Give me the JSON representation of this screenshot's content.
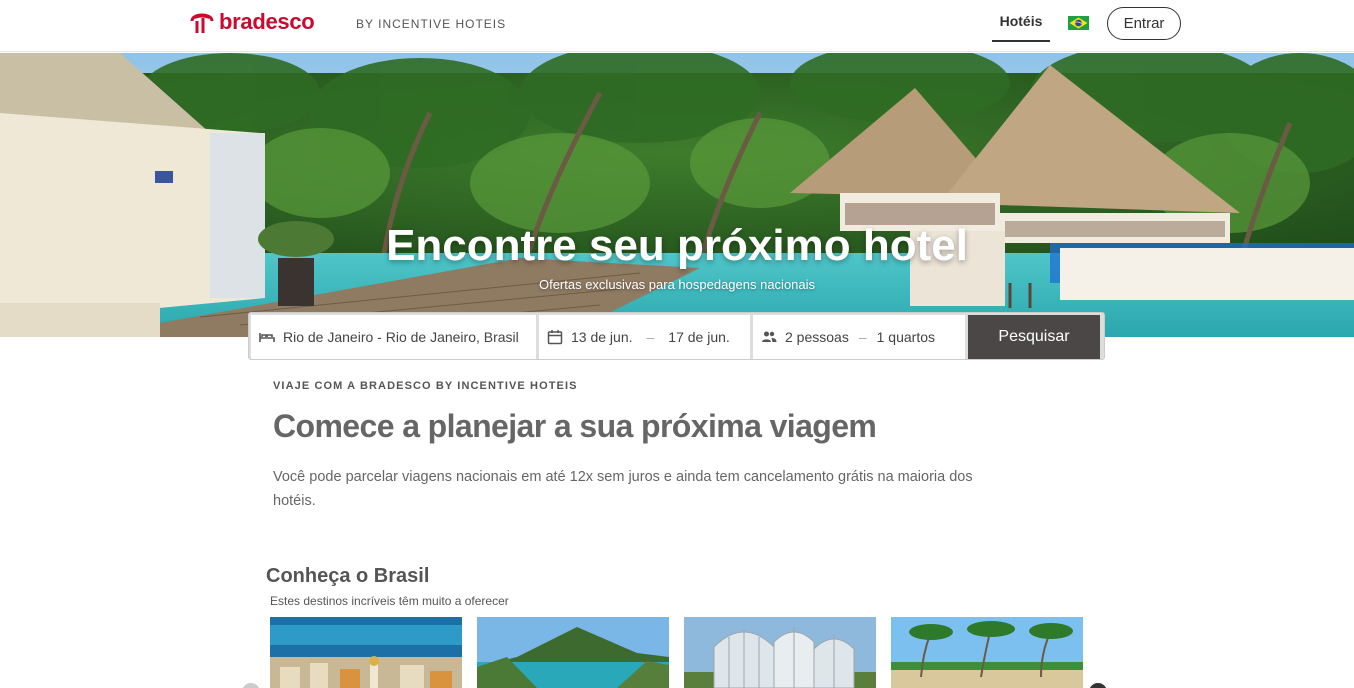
{
  "header": {
    "brand": "bradesco",
    "tagline": "BY INCENTIVE HOTEIS",
    "nav_hotels": "Hotéis",
    "login": "Entrar",
    "colors": {
      "brand": "#cc092f"
    }
  },
  "hero": {
    "title": "Encontre seu próximo hotel",
    "subtitle": "Ofertas exclusivas para hospedagens nacionais"
  },
  "search": {
    "destination": "Rio de Janeiro - Rio de Janeiro, Brasil",
    "checkin": "13 de jun.",
    "date_separator": "–",
    "checkout": "17 de jun.",
    "guests": "2 pessoas",
    "guests_separator": "–",
    "rooms": "1 quartos",
    "button": "Pesquisar",
    "icons": {
      "destination": "bed-icon",
      "dates": "calendar-icon",
      "guests": "people-icon"
    }
  },
  "intro": {
    "eyebrow": "VIAJE COM A BRADESCO BY INCENTIVE HOTEIS",
    "title": "Comece a planejar a sua próxima viagem",
    "text": "Você pode parcelar viagens nacionais em até 12x sem juros e ainda tem cancelamento grátis na maioria dos hotéis."
  },
  "destinations": {
    "title": "Conheça o Brasil",
    "subtitle": "Estes destinos incríveis têm muito a oferecer"
  }
}
